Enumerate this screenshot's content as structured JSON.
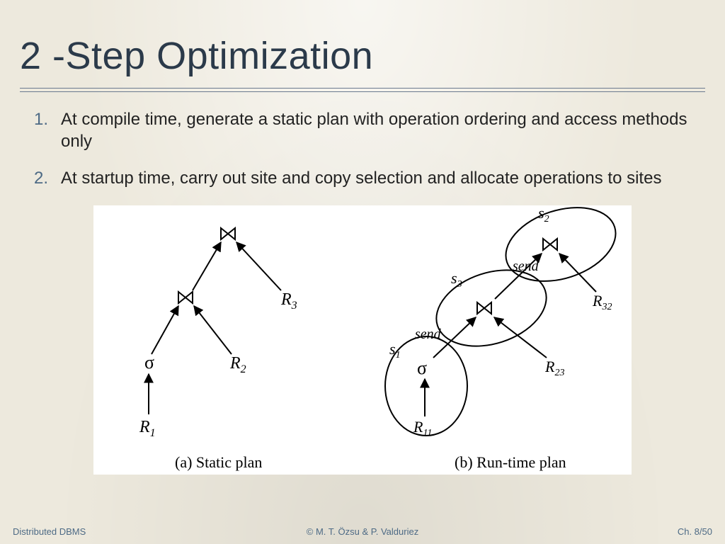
{
  "title": "2 -Step Optimization",
  "points": [
    "At compile time, generate a static plan with operation ordering and access methods only",
    "At startup time, carry out site and copy selection and allocate operations to sites"
  ],
  "diagram": {
    "left_caption": "(a) Static plan",
    "right_caption": "(b) Run-time plan",
    "labels": {
      "R1": "R",
      "R1_sub": "1",
      "R2": "R",
      "R2_sub": "2",
      "R3": "R",
      "R3_sub": "3",
      "R11": "R",
      "R11_sub": "11",
      "R23": "R",
      "R23_sub": "23",
      "R32": "R",
      "R32_sub": "32",
      "s1": "s",
      "s1_sub": "1",
      "s2": "s",
      "s2_sub": "2",
      "s3": "s",
      "s3_sub": "3",
      "sigma": "σ",
      "send1": "send",
      "send2": "send"
    }
  },
  "footer": {
    "left": "Distributed DBMS",
    "center": "© M. T. Özsu & P. Valduriez",
    "right": "Ch. 8/50"
  }
}
